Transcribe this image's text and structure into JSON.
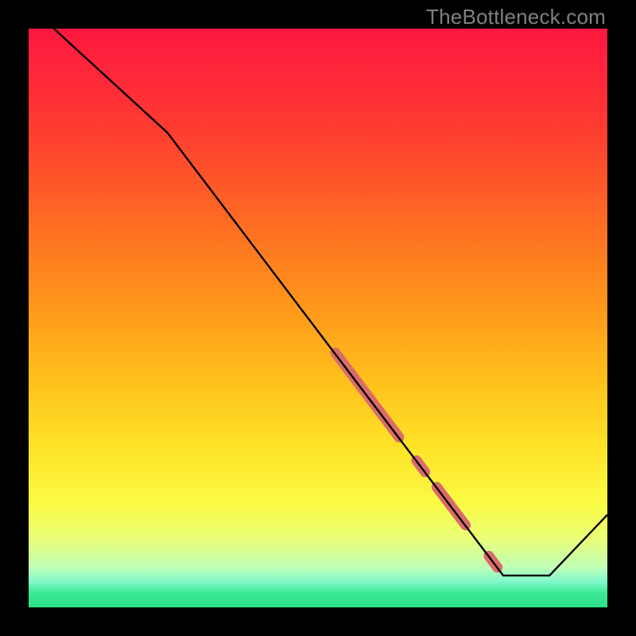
{
  "watermark": "TheBottleneck.com",
  "chart_data": {
    "type": "line",
    "title": "",
    "xlabel": "",
    "ylabel": "",
    "xlim": [
      0,
      100
    ],
    "ylim": [
      0,
      100
    ],
    "curve": {
      "x": [
        0,
        24,
        82,
        90,
        100
      ],
      "y": [
        104,
        82,
        5.5,
        5.5,
        16
      ]
    },
    "highlight_segments": [
      {
        "x0": 53,
        "y0": 44.0,
        "x1": 64,
        "y1": 29.4
      },
      {
        "x0": 67,
        "y0": 25.4,
        "x1": 68.5,
        "y1": 23.4
      },
      {
        "x0": 70.5,
        "y0": 20.8,
        "x1": 75.5,
        "y1": 14.2
      },
      {
        "x0": 79.5,
        "y0": 8.9,
        "x1": 81,
        "y1": 6.9
      }
    ],
    "gradient_stops": [
      {
        "offset": 0.0,
        "color": "#fe1840"
      },
      {
        "offset": 0.12,
        "color": "#fe2f36"
      },
      {
        "offset": 0.24,
        "color": "#fe4f2b"
      },
      {
        "offset": 0.36,
        "color": "#fe7321"
      },
      {
        "offset": 0.48,
        "color": "#fe971b"
      },
      {
        "offset": 0.6,
        "color": "#ffbe1b"
      },
      {
        "offset": 0.72,
        "color": "#fee227"
      },
      {
        "offset": 0.82,
        "color": "#fbfb44"
      },
      {
        "offset": 0.88,
        "color": "#eafe76"
      },
      {
        "offset": 0.93,
        "color": "#c1feb5"
      },
      {
        "offset": 0.955,
        "color": "#82f9cc"
      },
      {
        "offset": 0.975,
        "color": "#3de995"
      },
      {
        "offset": 1.0,
        "color": "#29e183"
      }
    ],
    "highlight_color": "#db6b6b",
    "line_color": "#000000"
  }
}
